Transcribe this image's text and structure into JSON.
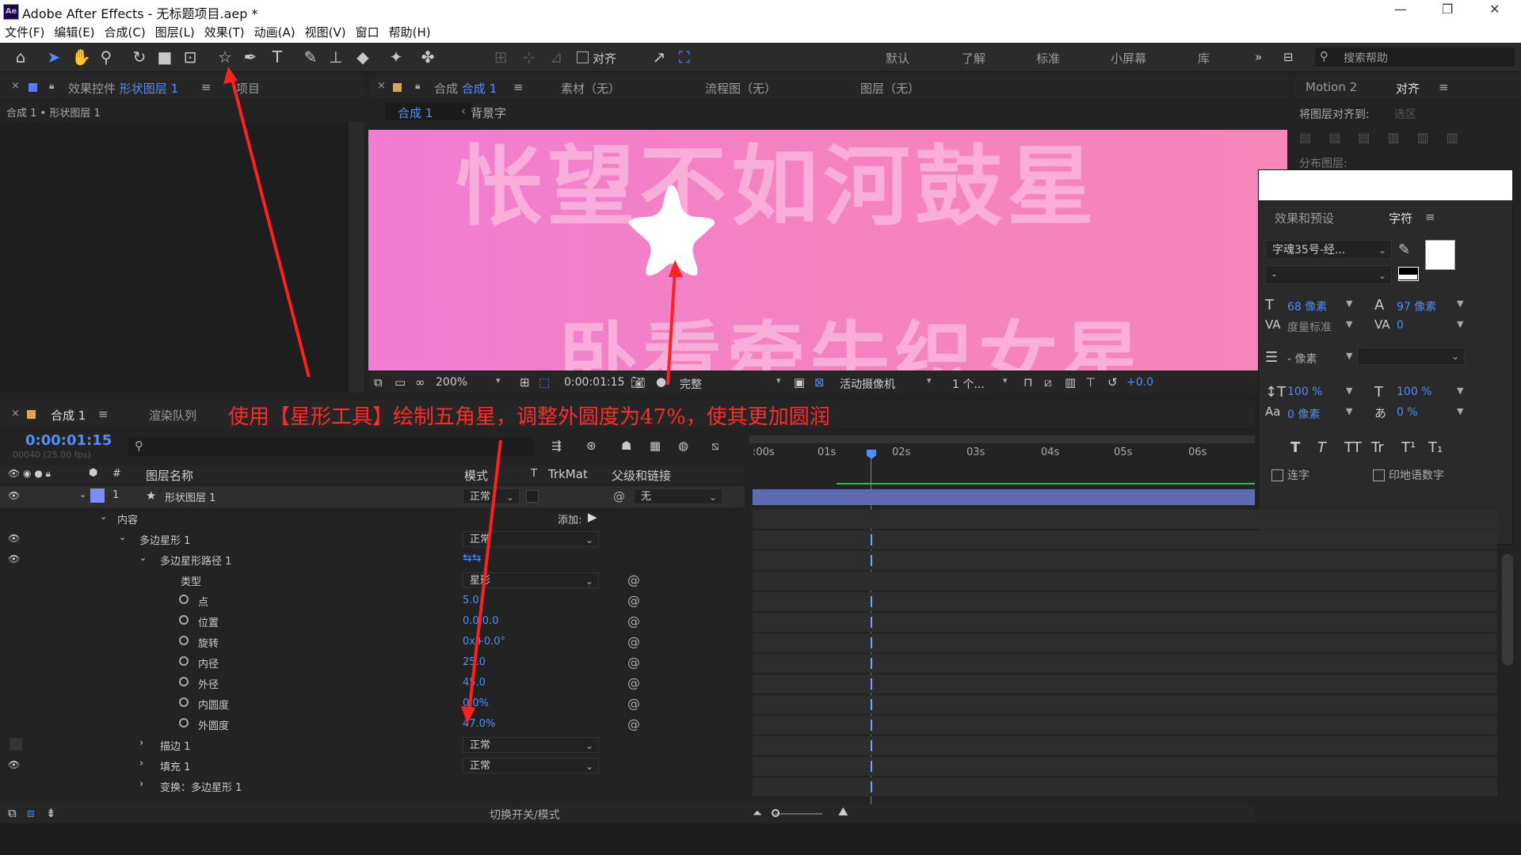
{
  "titlebar": {
    "logo": "Ae",
    "title": "Adobe After Effects - 无标题项目.aep *",
    "win_min": "—",
    "win_restore": "❐",
    "win_close": "✕"
  },
  "menu": [
    "文件(F)",
    "编辑(E)",
    "合成(C)",
    "图层(L)",
    "效果(T)",
    "动画(A)",
    "视图(V)",
    "窗口",
    "帮助(H)"
  ],
  "toolbar": {
    "tools": [
      "home-icon",
      "selection-arrow-icon",
      "hand-icon",
      "zoom-icon",
      "rotate-icon",
      "camera-icon",
      "pan-behind-icon",
      "star-shape-icon",
      "pen-icon",
      "text-icon",
      "brush-icon",
      "clone-stamp-icon",
      "eraser-icon",
      "roto-brush-icon",
      "puppet-pin-icon"
    ],
    "snap_label": "对齐",
    "workspaces": [
      "默认",
      "了解",
      "标准",
      "小屏幕",
      "库"
    ],
    "search_placeholder": "搜索帮助"
  },
  "effects_panel": {
    "tab": "效果控件",
    "tab_layer": "形状图层 1",
    "project_tab": "项目",
    "breadcrumb": "合成 1 • 形状图层 1"
  },
  "comp_panel": {
    "tab_prefix": "合成",
    "tab_name": "合成 1",
    "tab_footage": "素材（无）",
    "tab_flow": "流程图（无）",
    "tab_layer": "图层（无）",
    "sub_tab": "合成 1",
    "sub_tab2": "背景字",
    "canvas_text_top": "怅望不如河鼓星",
    "canvas_text_bottom": "卧看牵牛织女星",
    "zoom": "200%",
    "timecode": "0:00:01:15",
    "quality": "完整",
    "camera": "活动摄像机",
    "views": "1 个...",
    "exposure": "+0.0"
  },
  "align_panel": {
    "tab_motion": "Motion 2",
    "tab_align": "对齐",
    "align_to_label": "将图层对齐到:",
    "align_to_value": "选区",
    "distribute_label": "分布图层:"
  },
  "character_panel": {
    "tab_effects": "效果和预设",
    "tab_char": "字符",
    "font": "字魂35号-经...",
    "font_style": "-",
    "size_value": "68 像素",
    "leading_value": "97 像素",
    "kerning_label": "度量标准",
    "tracking_value": "0",
    "stroke_unit": "- 像素",
    "vscale": "100 %",
    "hscale": "100 %",
    "baseline": "0 像素",
    "tsume": "0 %",
    "styles": [
      "T",
      "T",
      "TT",
      "Tr",
      "T¹",
      "T₁"
    ],
    "ligature": "连字",
    "hindi": "印地语数字"
  },
  "timeline": {
    "tab": "合成 1",
    "render_tab": "渲染队列",
    "timecode": "0:00:01:15",
    "fps": "00040 (25.00 fps)",
    "annotation": "使用【星形工具】绘制五角星，调整外圆度为47%，使其更加圆润",
    "headers": {
      "layer_name": "图层名称",
      "mode": "模式",
      "t": "T",
      "trkmat": "TrkMat",
      "parent": "父级和链接",
      "num": "#"
    },
    "ruler": [
      ":00s",
      "01s",
      "02s",
      "03s",
      "04s",
      "05s",
      "06s"
    ],
    "layer": {
      "num": "1",
      "name": "形状图层 1",
      "mode": "正常",
      "parent": "无"
    },
    "content_label": "内容",
    "add_label": "添加:",
    "polystar": {
      "name": "多边星形 1",
      "mode": "正常"
    },
    "path": {
      "name": "多边星形路径 1"
    },
    "props": [
      {
        "label": "类型",
        "value": "星形",
        "dropdown": true
      },
      {
        "label": "点",
        "value": "5.0"
      },
      {
        "label": "位置",
        "value": "0.0,0.0"
      },
      {
        "label": "旋转",
        "value": "0x+0.0°"
      },
      {
        "label": "内径",
        "value": "25.0"
      },
      {
        "label": "外径",
        "value": "45.0"
      },
      {
        "label": "内圆度",
        "value": "0.0%"
      },
      {
        "label": "外圆度",
        "value": "47.0%"
      }
    ],
    "stroke": {
      "name": "描边 1",
      "mode": "正常"
    },
    "fill": {
      "name": "填充 1",
      "mode": "正常"
    },
    "transform": {
      "name": "变换：多边星形 1"
    },
    "footer": "切换开关/模式"
  }
}
